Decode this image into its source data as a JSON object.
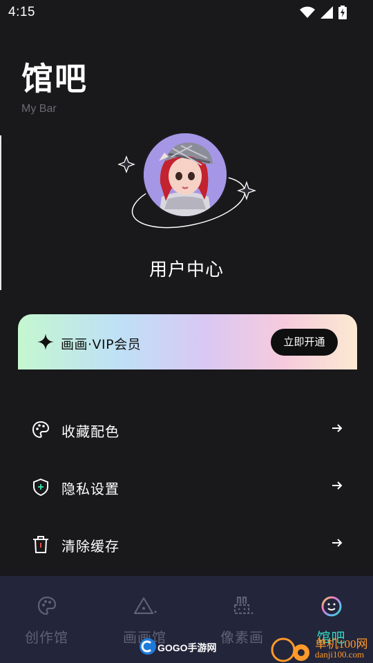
{
  "status_bar": {
    "time": "4:15",
    "icons": [
      "wifi-icon",
      "signal-icon",
      "battery-charging-icon"
    ]
  },
  "header": {
    "title": "馆吧",
    "subtitle": "My Bar"
  },
  "profile": {
    "avatar": "avatar",
    "label": "用户中心"
  },
  "vip": {
    "icon": "sparkle-icon",
    "label": "画画·VIP会员",
    "button": "立即开通"
  },
  "menu": {
    "items": [
      {
        "icon": "palette-icon",
        "label": "收藏配色",
        "arrow": "arrow-right-icon"
      },
      {
        "icon": "shield-plus-icon",
        "label": "隐私设置",
        "arrow": "arrow-right-icon"
      },
      {
        "icon": "trash-icon",
        "label": "清除缓存",
        "arrow": "arrow-right-icon"
      }
    ]
  },
  "tabs": [
    {
      "icon": "palette-icon",
      "label": "创作馆",
      "active": false
    },
    {
      "icon": "triangle-icon",
      "label": "画画馆",
      "active": false
    },
    {
      "icon": "rabbit-icon",
      "label": "像素画",
      "active": false
    },
    {
      "icon": "smile-icon",
      "label": "馆吧",
      "active": true
    }
  ],
  "watermarks": {
    "left": "GOGO手游网",
    "right_top": "单机100网",
    "right_bottom": "danji100.com"
  },
  "colors": {
    "background": "#19181b",
    "tab_bar": "#23253a",
    "active_tab": "#33d7c0",
    "inactive_tab": "#5f6174"
  }
}
